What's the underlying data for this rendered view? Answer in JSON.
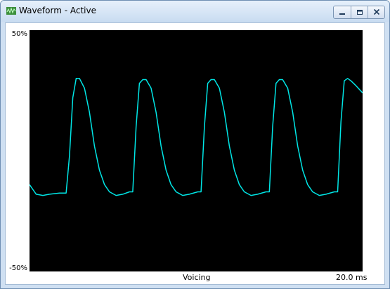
{
  "window": {
    "title": "Waveform - Active",
    "controls": {
      "minimize_icon": "minimize-icon",
      "maximize_icon": "maximize-icon",
      "close_icon": "close-icon"
    }
  },
  "chart_data": {
    "type": "line",
    "ylim": [
      -50,
      50
    ],
    "xlim": [
      0,
      20
    ],
    "y_top_label": "50%",
    "y_bottom_label": "-50%",
    "center_label": "Voicing",
    "x_end_label": "20.0 ms",
    "grid": false,
    "colors": {
      "background": "#000000",
      "trace": "#00e6e6"
    },
    "series": [
      {
        "x": [
          0,
          0.2,
          0.4,
          0.8,
          1.2,
          1.8,
          2.2,
          2.4,
          2.6,
          2.8,
          3.0,
          3.3,
          3.6,
          3.9,
          4.2,
          4.5,
          4.8,
          5.2,
          5.6,
          6.0,
          6.2,
          6.4,
          6.6,
          6.8,
          7.0,
          7.3,
          7.6,
          7.9,
          8.2,
          8.5,
          8.8,
          9.2,
          9.6,
          10.1,
          10.3,
          10.5,
          10.7,
          10.9,
          11.1,
          11.4,
          11.7,
          12.0,
          12.3,
          12.6,
          12.9,
          13.3,
          13.7,
          14.2,
          14.4,
          14.6,
          14.8,
          15.0,
          15.2,
          15.5,
          15.8,
          16.1,
          16.4,
          16.7,
          17.0,
          17.4,
          17.8,
          18.3,
          18.5,
          18.7,
          18.9,
          19.1,
          19.3,
          19.6,
          20.0
        ],
        "y": [
          -14,
          -16,
          -18,
          -18.5,
          -18,
          -17.5,
          -17.5,
          -2,
          22,
          30,
          30,
          26,
          16,
          2,
          -8,
          -14,
          -17,
          -18.5,
          -18,
          -17,
          -17,
          10,
          28,
          29.5,
          29.5,
          26,
          16,
          2,
          -8,
          -14,
          -17,
          -18.5,
          -18,
          -17,
          -17,
          10,
          28,
          29.5,
          29.5,
          26,
          16,
          2,
          -8,
          -14,
          -17,
          -18.5,
          -18,
          -17,
          -17,
          10,
          28,
          29.5,
          29.5,
          26,
          16,
          2,
          -8,
          -14,
          -17,
          -18.5,
          -18,
          -17,
          -17,
          12,
          29,
          30,
          29,
          27,
          24
        ]
      }
    ]
  }
}
